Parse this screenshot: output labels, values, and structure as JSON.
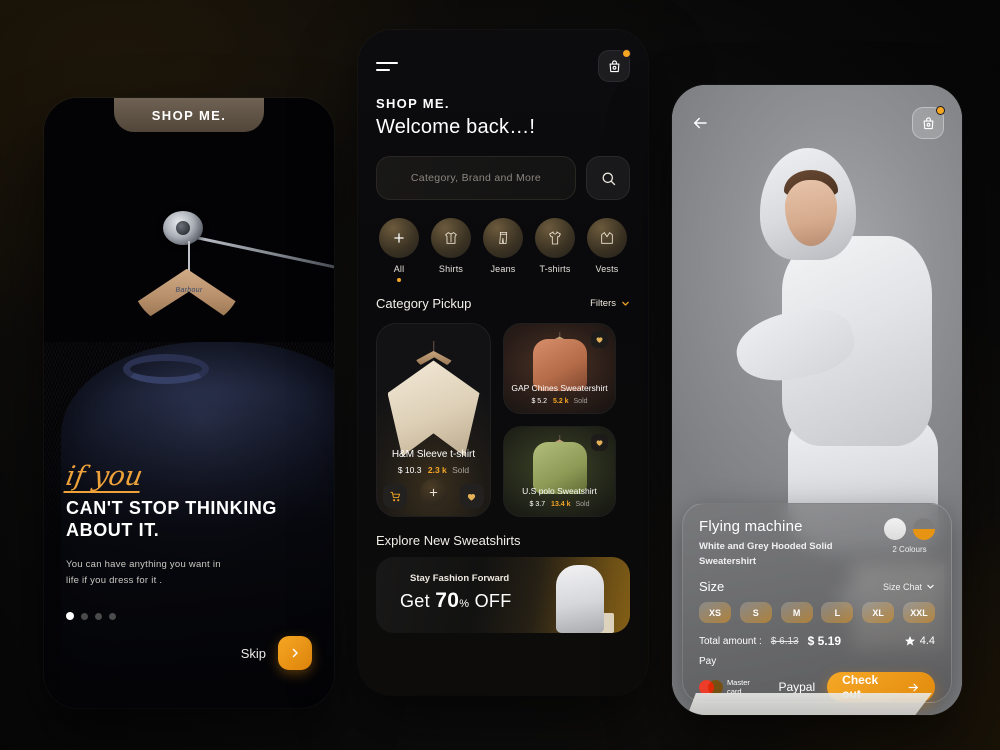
{
  "onboarding": {
    "top_tab_label": "SHOP ME.",
    "script_text": "if you",
    "headline_line1": "CAN'T STOP THINKING",
    "headline_line2": "ABOUT IT.",
    "subcopy_line1": "You can have anything you want in",
    "subcopy_line2": "life if you dress for it .",
    "pagination": {
      "total": 4,
      "active_index": 0
    },
    "skip_label": "Skip",
    "skip_icon": "chevron-right-icon",
    "hanger_brand": "Barbour"
  },
  "home": {
    "menu_icon": "hamburger-menu-icon",
    "cart_icon": "shopping-bag-icon",
    "cart_has_badge": true,
    "brand": "SHOP ME.",
    "welcome": "Welcome back…!",
    "search": {
      "placeholder": "Category, Brand and More",
      "value": "",
      "icon": "search-icon"
    },
    "categories": [
      {
        "label": "All",
        "icon": "plus-icon",
        "active": true
      },
      {
        "label": "Shirts",
        "icon": "shirt-icon",
        "active": false
      },
      {
        "label": "Jeans",
        "icon": "jeans-icon",
        "active": false
      },
      {
        "label": "T-shirts",
        "icon": "tshirt-icon",
        "active": false
      },
      {
        "label": "Vests",
        "icon": "vest-icon",
        "active": false
      }
    ],
    "section_title": "Category Pickup",
    "filters_label": "Filters",
    "filters_icon": "chevron-down-icon",
    "featured_product": {
      "title": "H&M Sleeve t-shirt",
      "price": "$ 10.3",
      "sold_count": "2.3 k",
      "sold_label": "Sold",
      "cart_icon": "cart-icon",
      "add_icon": "plus-icon",
      "wishlist_icon": "heart-icon"
    },
    "side_products": [
      {
        "title": "GAP Chines Sweatershirt",
        "price": "$ 5.2",
        "sold_count": "5.2 k",
        "sold_label": "Sold",
        "wishlist_icon": "heart-icon"
      },
      {
        "title": "U.S polo Sweatshirt",
        "price": "$ 3.7",
        "sold_count": "13.4 k",
        "sold_label": "Sold",
        "wishlist_icon": "heart-icon"
      }
    ],
    "explore_title": "Explore New Sweatshirts",
    "promo": {
      "kicker": "Stay Fashion Forward",
      "headline_prefix": "Get",
      "headline_value": "70",
      "headline_percent": "%",
      "headline_suffix": "OFF"
    }
  },
  "product": {
    "back_icon": "arrow-left-icon",
    "cart_icon": "shopping-bag-icon",
    "cart_has_badge": true,
    "name": "Flying machine",
    "description": "White and Grey Hooded Solid Sweatershirt",
    "colours_label": "2 Colours",
    "colour_swatches": [
      "#eeeeee",
      "#7c7c7c"
    ],
    "size_label": "Size",
    "size_chart_label": "Size Chat",
    "size_chart_icon": "chevron-down-icon",
    "sizes": [
      "XS",
      "S",
      "M",
      "L",
      "XL",
      "XXL"
    ],
    "total_label": "Total amount :",
    "old_price": "$ 6.13",
    "new_price": "$ 5.19",
    "rating": "4.4",
    "rating_icon": "star-icon",
    "pay_label": "Pay",
    "payment_methods": [
      {
        "label": "Master card",
        "icon": "mastercard-icon"
      },
      {
        "label": "Paypal",
        "icon": "paypal-icon"
      }
    ],
    "checkout_label": "Check out",
    "checkout_icon": "arrow-right-icon"
  },
  "theme": {
    "accent": "#f5a623",
    "dark": "#0a0a0c",
    "background_glow": "#8a5c10"
  }
}
